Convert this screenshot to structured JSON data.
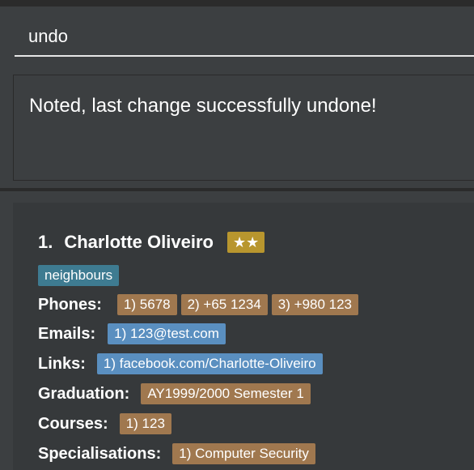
{
  "command": {
    "value": "undo"
  },
  "result": {
    "text": "Noted, last change successfully undone!"
  },
  "person": {
    "index": "1.",
    "name": "Charlotte Oliveiro",
    "stars": "★★",
    "tags": [
      "neighbours"
    ],
    "phones_label": "Phones:",
    "phones": [
      "1) 5678",
      "2) +65 1234",
      "3) +980 123"
    ],
    "emails_label": "Emails:",
    "emails": [
      "1) 123@test.com"
    ],
    "links_label": "Links:",
    "links": [
      "1) facebook.com/Charlotte-Oliveiro"
    ],
    "graduation_label": "Graduation:",
    "graduation": "AY1999/2000 Semester 1",
    "courses_label": "Courses:",
    "courses": [
      "1) 123"
    ],
    "specialisations_label": "Specialisations:",
    "specialisations": [
      "1) Computer Security"
    ]
  },
  "colors": {
    "background": "#3c3f41",
    "card": "#36393b",
    "tag": "#3e7b91",
    "email_link_chip": "#5a8fc0",
    "info_chip": "#a0784f",
    "stars_badge": "#b8962e"
  }
}
